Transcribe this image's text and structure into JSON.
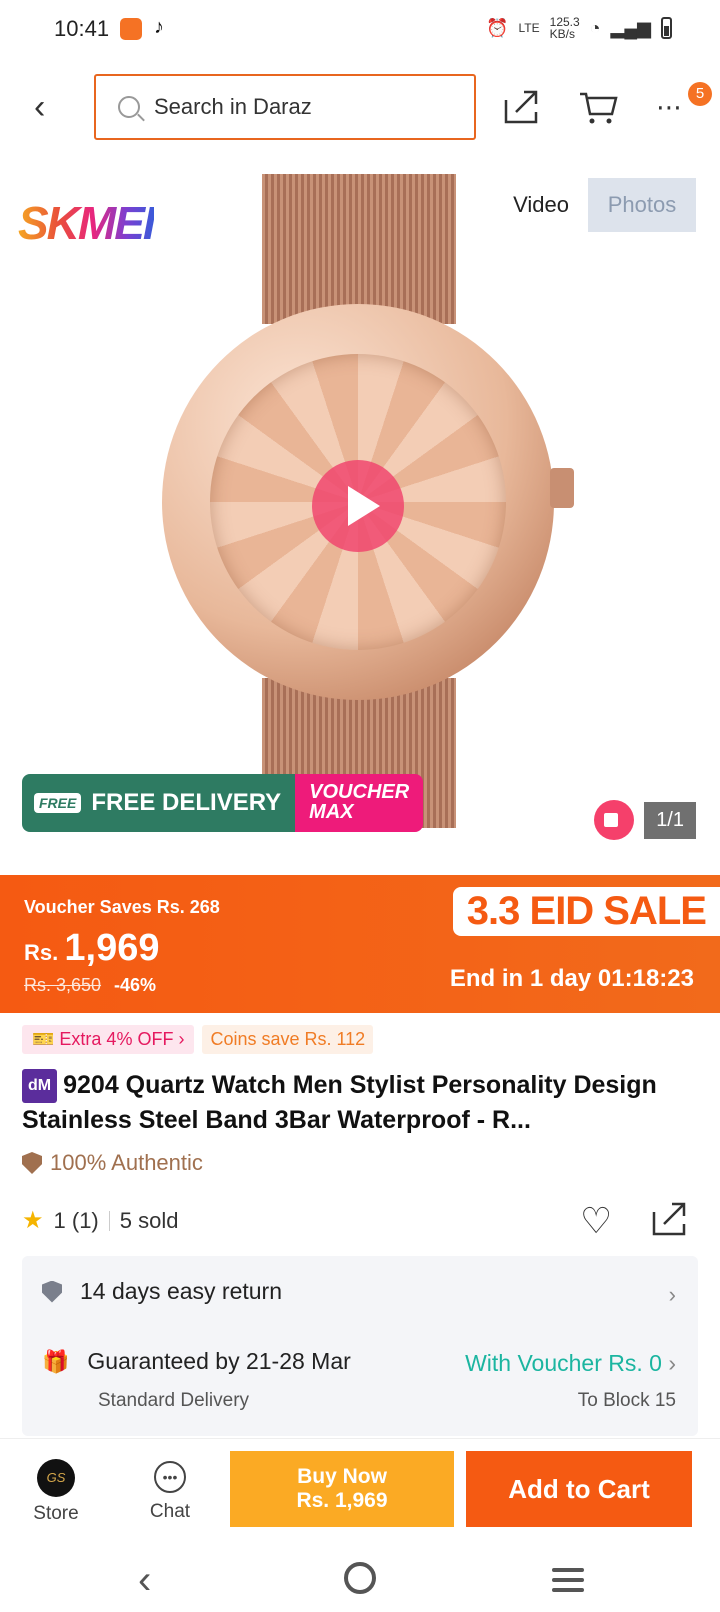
{
  "status_bar": {
    "time": "10:41",
    "net_speed": "125.3\nKB/s",
    "lte": "LTE"
  },
  "search": {
    "placeholder": "Search in Daraz"
  },
  "cart_badge": "5",
  "gallery": {
    "brand_logo": "SKMEI",
    "tab_video": "Video",
    "tab_photos": "Photos",
    "counter": "1/1"
  },
  "promo": {
    "free_delivery": "FREE DELIVERY",
    "free_tag": "FREE",
    "voucher_max": "VOUCHER",
    "voucher_max2": "MAX"
  },
  "sale": {
    "voucher_saves": "Voucher Saves Rs. 268",
    "currency": "Rs.",
    "price": "1,969",
    "old_price": "Rs. 3,650",
    "discount": "-46%",
    "event": "3.3 EID SALE",
    "countdown": "End in 1 day 01:18:23"
  },
  "tags": {
    "extra_off": "Extra 4% OFF",
    "coins": "Coins save Rs. 112"
  },
  "product": {
    "badge": "dM",
    "title": "9204 Quartz Watch Men Stylist Personality Design Stainless Steel Band 3Bar Waterproof - R...",
    "authentic": "100% Authentic",
    "rating": "1 (1)",
    "sold": "5 sold"
  },
  "service": {
    "return": "14 days easy return",
    "guarantee": "Guaranteed by 21-28 Mar",
    "voucher": "With Voucher Rs. 0",
    "delivery_type": "Standard Delivery",
    "location": "To Block 15"
  },
  "bottom_bar": {
    "store": "Store",
    "store_avatar": "GS",
    "chat": "Chat",
    "buy_now": "Buy Now",
    "buy_price": "Rs. 1,969",
    "add_to_cart": "Add to Cart"
  },
  "colors": {
    "accent": "#f55a12",
    "buy": "#fbaa24",
    "teal": "#1bb5a0",
    "authentic": "#a0704f"
  }
}
